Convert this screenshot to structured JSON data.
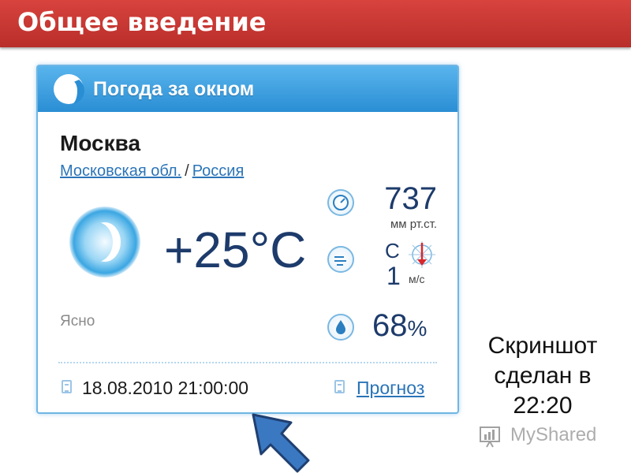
{
  "slide": {
    "title": "Общее введение"
  },
  "widget": {
    "header_title": "Погода за окном",
    "city": "Москва",
    "region_link": "Московская обл.",
    "region_separator": "/",
    "country_link": "Россия",
    "temperature": "+25°C",
    "condition": "Ясно",
    "pressure_value": "737",
    "pressure_unit": "мм рт.ст.",
    "wind_direction": "С",
    "wind_speed": "1",
    "wind_unit": "м/с",
    "humidity_value": "68",
    "humidity_unit": "%",
    "datetime": "18.08.2010 21:00:00",
    "forecast_link": "Прогноз"
  },
  "caption": {
    "line1": "Скриншот",
    "line2": "сделан в",
    "line3": "22:20"
  },
  "watermark": {
    "text": "MyShared"
  },
  "colors": {
    "slide_header": "#c9393a",
    "widget_header": "#3a9fe0",
    "value_text": "#1d3b6b",
    "link": "#2a74b8",
    "arrow": "#3a78c2"
  }
}
